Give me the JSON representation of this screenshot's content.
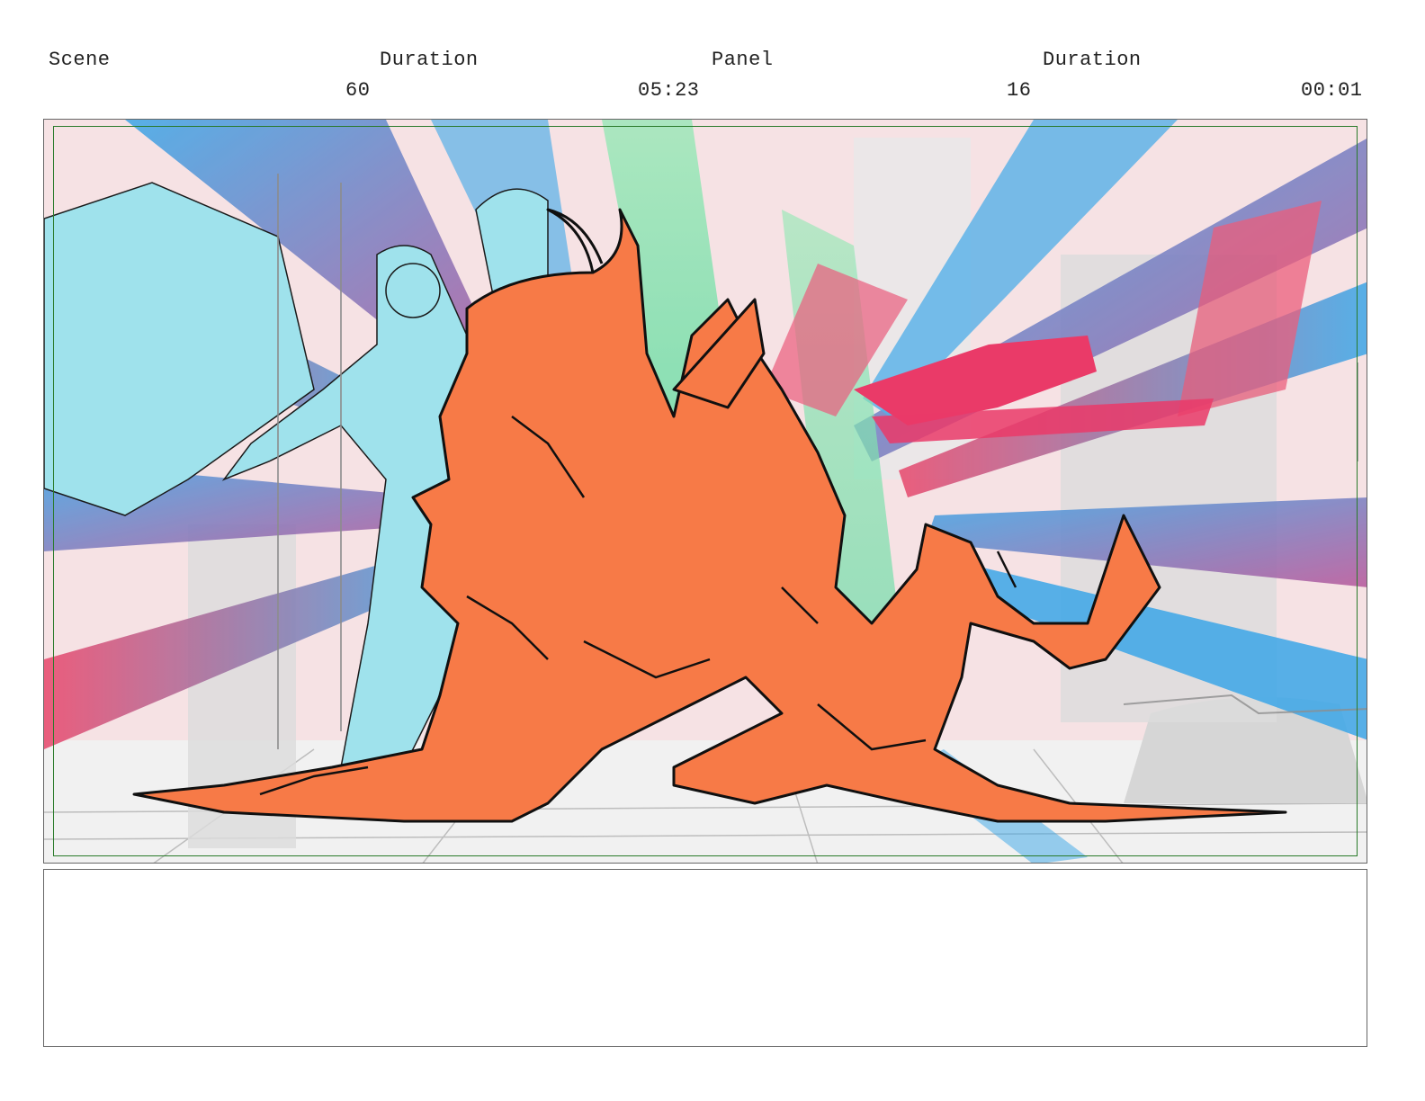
{
  "header": {
    "scene_label": "Scene",
    "scene_duration_label": "Duration",
    "panel_label": "Panel",
    "panel_duration_label": "Duration",
    "scene_number": "60",
    "scene_duration": "05:23",
    "panel_number": "16",
    "panel_duration": "00:01"
  },
  "notes": {
    "text": ""
  },
  "colors": {
    "figure_fill": "#f77a47",
    "ghost_fill": "#9fe2ec",
    "streak_red": "#e8456a",
    "streak_blue": "#3aa6e8",
    "streak_green": "#6ee39a",
    "background": "#f6e2e4",
    "safe_frame": "#2a7a2a"
  }
}
